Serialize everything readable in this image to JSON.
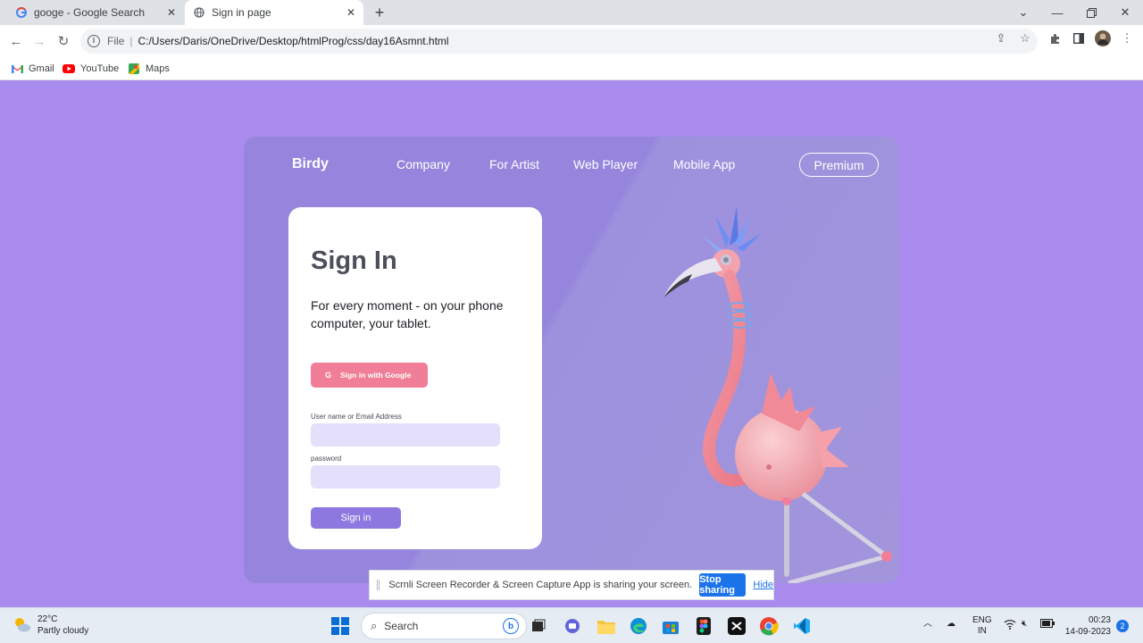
{
  "browser": {
    "tabs": [
      {
        "title": "googe - Google Search",
        "icon": "google-g-icon",
        "active": false
      },
      {
        "title": "Sign in page",
        "icon": "globe-icon",
        "active": true
      }
    ],
    "address": {
      "scheme": "File",
      "url": "C:/Users/Daris/OneDrive/Desktop/htmlProg/css/day16Asmnt.html"
    },
    "bookmarks": [
      {
        "label": "Gmail",
        "icon": "gmail-icon"
      },
      {
        "label": "YouTube",
        "icon": "youtube-icon"
      },
      {
        "label": "Maps",
        "icon": "maps-icon"
      }
    ]
  },
  "page": {
    "logo": "Birdy",
    "nav": [
      "Company",
      "For Artist",
      "Web Player",
      "Mobile App"
    ],
    "premium": "Premium",
    "signin": {
      "title": "Sign In",
      "tagline": "For every moment - on your phone computer, your tablet.",
      "google_button": "Sign in with Google",
      "google_glyph": "G",
      "username_label": "User name or Email Address",
      "password_label": "password",
      "submit": "Sign in"
    },
    "colors": {
      "background": "#a98bee",
      "card": "#9585dc",
      "google_button": "#f07e98",
      "input": "#e4e0fb",
      "submit": "#8d78df"
    }
  },
  "sharebar": {
    "message": "Scrnli Screen Recorder & Screen Capture App is sharing your screen.",
    "stop": "Stop sharing",
    "hide": "Hide"
  },
  "taskbar": {
    "weather": {
      "temp": "22°C",
      "condition": "Partly cloudy"
    },
    "search": "Search",
    "language": {
      "line1": "ENG",
      "line2": "IN"
    },
    "time": "00:23",
    "date": "14-09-2023",
    "notifications": "2"
  }
}
